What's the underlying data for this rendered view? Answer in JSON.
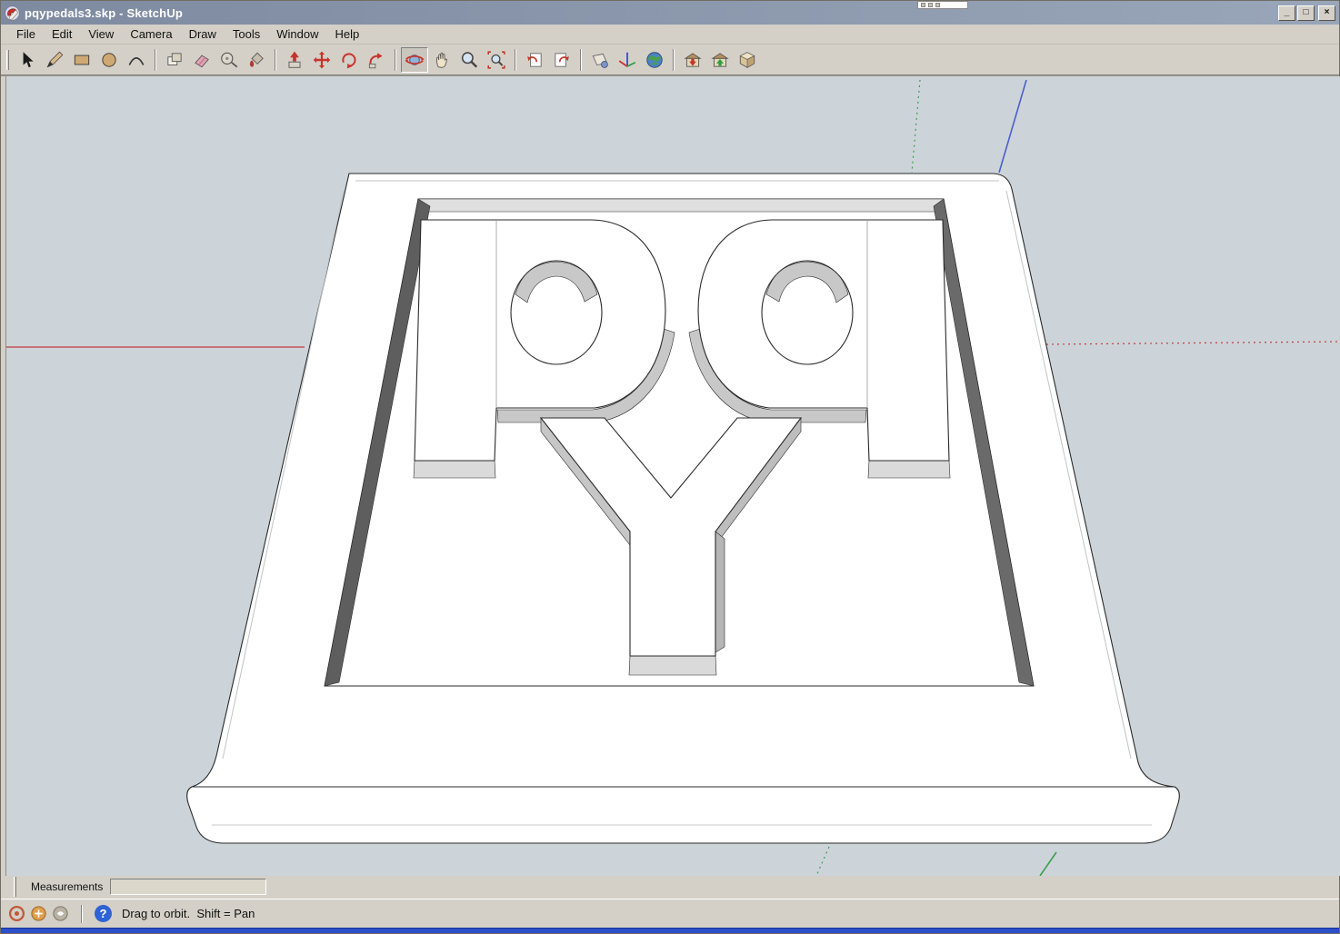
{
  "window": {
    "title": "pqypedals3.skp - SketchUp",
    "app_icon": "sketchup-icon"
  },
  "window_controls": [
    {
      "name": "minimize",
      "glyph": "_"
    },
    {
      "name": "maximize",
      "glyph": "□"
    },
    {
      "name": "close",
      "glyph": "×"
    }
  ],
  "menu": {
    "items": [
      "File",
      "Edit",
      "View",
      "Camera",
      "Draw",
      "Tools",
      "Window",
      "Help"
    ]
  },
  "toolbar": {
    "active_tool": "orbit-tool",
    "groups": [
      [
        "select-tool",
        "line-tool",
        "rectangle-tool",
        "circle-tool",
        "arc-tool"
      ],
      [
        "make-component-tool",
        "eraser-tool",
        "tape-measure-tool",
        "paint-bucket-tool"
      ],
      [
        "push-pull-tool",
        "move-tool",
        "rotate-tool",
        "follow-me-tool"
      ],
      [
        "orbit-tool",
        "pan-tool",
        "zoom-tool",
        "zoom-extents-tool"
      ],
      [
        "previous-view-tool",
        "next-view-tool"
      ],
      [
        "section-plane-tool",
        "axes-tool",
        "google-earth-tool"
      ],
      [
        "get-models-tool",
        "share-models-tool",
        "components-tool"
      ]
    ]
  },
  "viewport": {
    "model_letters": [
      "p",
      "q",
      "Y"
    ],
    "sky_color": "#ccd4d9",
    "axis_colors": {
      "red": "#c23b3b",
      "green": "#3f9e4f",
      "blue": "#4a5fd0"
    }
  },
  "measurements": {
    "label": "Measurements",
    "value": ""
  },
  "statusbar": {
    "toggle_icons": [
      "status-toggle-1",
      "status-toggle-2",
      "status-toggle-3"
    ],
    "help_glyph": "?",
    "hint": "Drag to orbit.  Shift = Pan"
  }
}
